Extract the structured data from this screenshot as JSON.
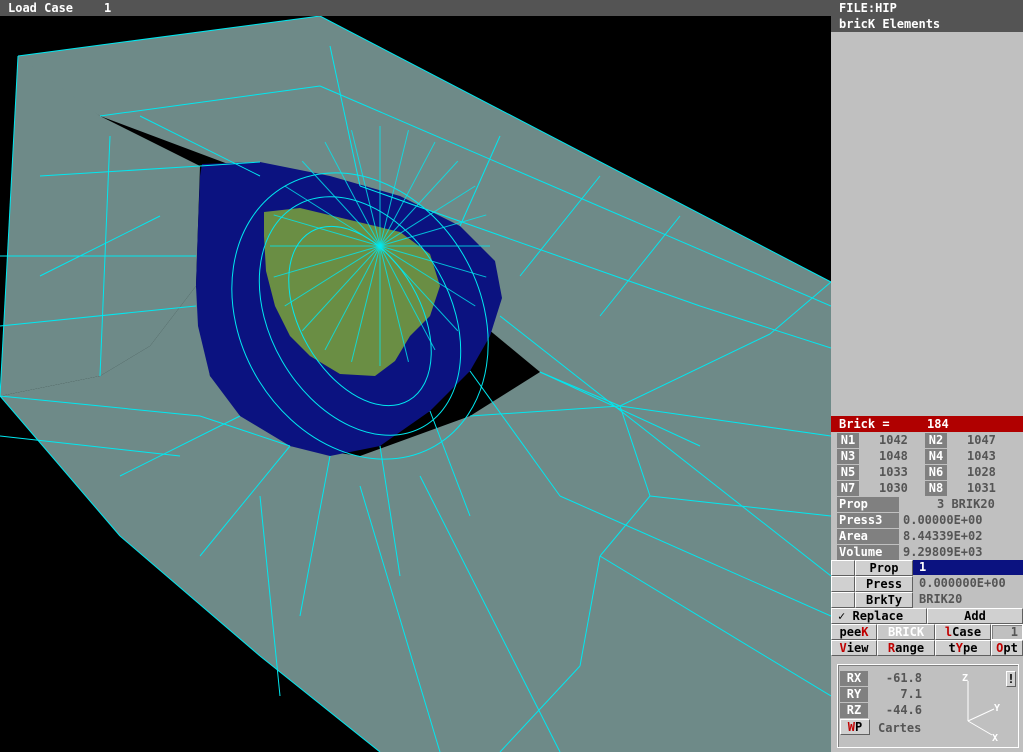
{
  "titlebar": {
    "load_case_label": "Load Case",
    "load_case_value": "1"
  },
  "panel": {
    "file_title": "FILE:HIP",
    "section_title": "bricK Elements",
    "brick_label": "Brick =",
    "brick_value": "184",
    "nodes": [
      {
        "label": "N1",
        "value": "1042"
      },
      {
        "label": "N2",
        "value": "1047"
      },
      {
        "label": "N3",
        "value": "1048"
      },
      {
        "label": "N4",
        "value": "1043"
      },
      {
        "label": "N5",
        "value": "1033"
      },
      {
        "label": "N6",
        "value": "1028"
      },
      {
        "label": "N7",
        "value": "1030"
      },
      {
        "label": "N8",
        "value": "1031"
      }
    ],
    "info": [
      {
        "label": "Prop",
        "value": "3 BRIK20"
      },
      {
        "label": "Press3",
        "value": "0.00000E+00"
      },
      {
        "label": "Area",
        "value": "8.44339E+02"
      },
      {
        "label": "Volume",
        "value": "9.29809E+03"
      }
    ],
    "edit": [
      {
        "label": "Prop",
        "value": "1"
      },
      {
        "label": "Press",
        "value": "0.000000E+00"
      },
      {
        "label": "BrkTy",
        "value": "BRIK20"
      }
    ],
    "replace_label": "Replace",
    "replace_check": "✓",
    "add_label": "Add",
    "peek": {
      "hot": "K",
      "rest": "pee"
    },
    "brick_button": "BRICK",
    "lcase": {
      "hot": "l",
      "rest": "Case"
    },
    "lcase_value": "1",
    "menu": [
      {
        "hot": "V",
        "rest": "iew"
      },
      {
        "hot": "R",
        "rest": "ange"
      },
      {
        "pre": "t",
        "hot": "Y",
        "rest": "pe"
      },
      {
        "hot": "O",
        "rest": "pt"
      }
    ],
    "rotation": [
      {
        "label": "RX",
        "value": "-61.8"
      },
      {
        "label": "RY",
        "value": "7.1"
      },
      {
        "label": "RZ",
        "value": "-44.6"
      }
    ],
    "wp": {
      "hot": "W",
      "rest": "P"
    },
    "coord_system": "Cartes",
    "axes": {
      "z": "Z",
      "y": "Y",
      "x": "X"
    },
    "info_glyph": "!"
  },
  "colors": {
    "mesh_line": "#00e8f0",
    "fill_grey": "#6e8a88",
    "fill_blue": "#0b1280",
    "fill_green": "#6a8e44",
    "active_bar": "#b00000"
  }
}
